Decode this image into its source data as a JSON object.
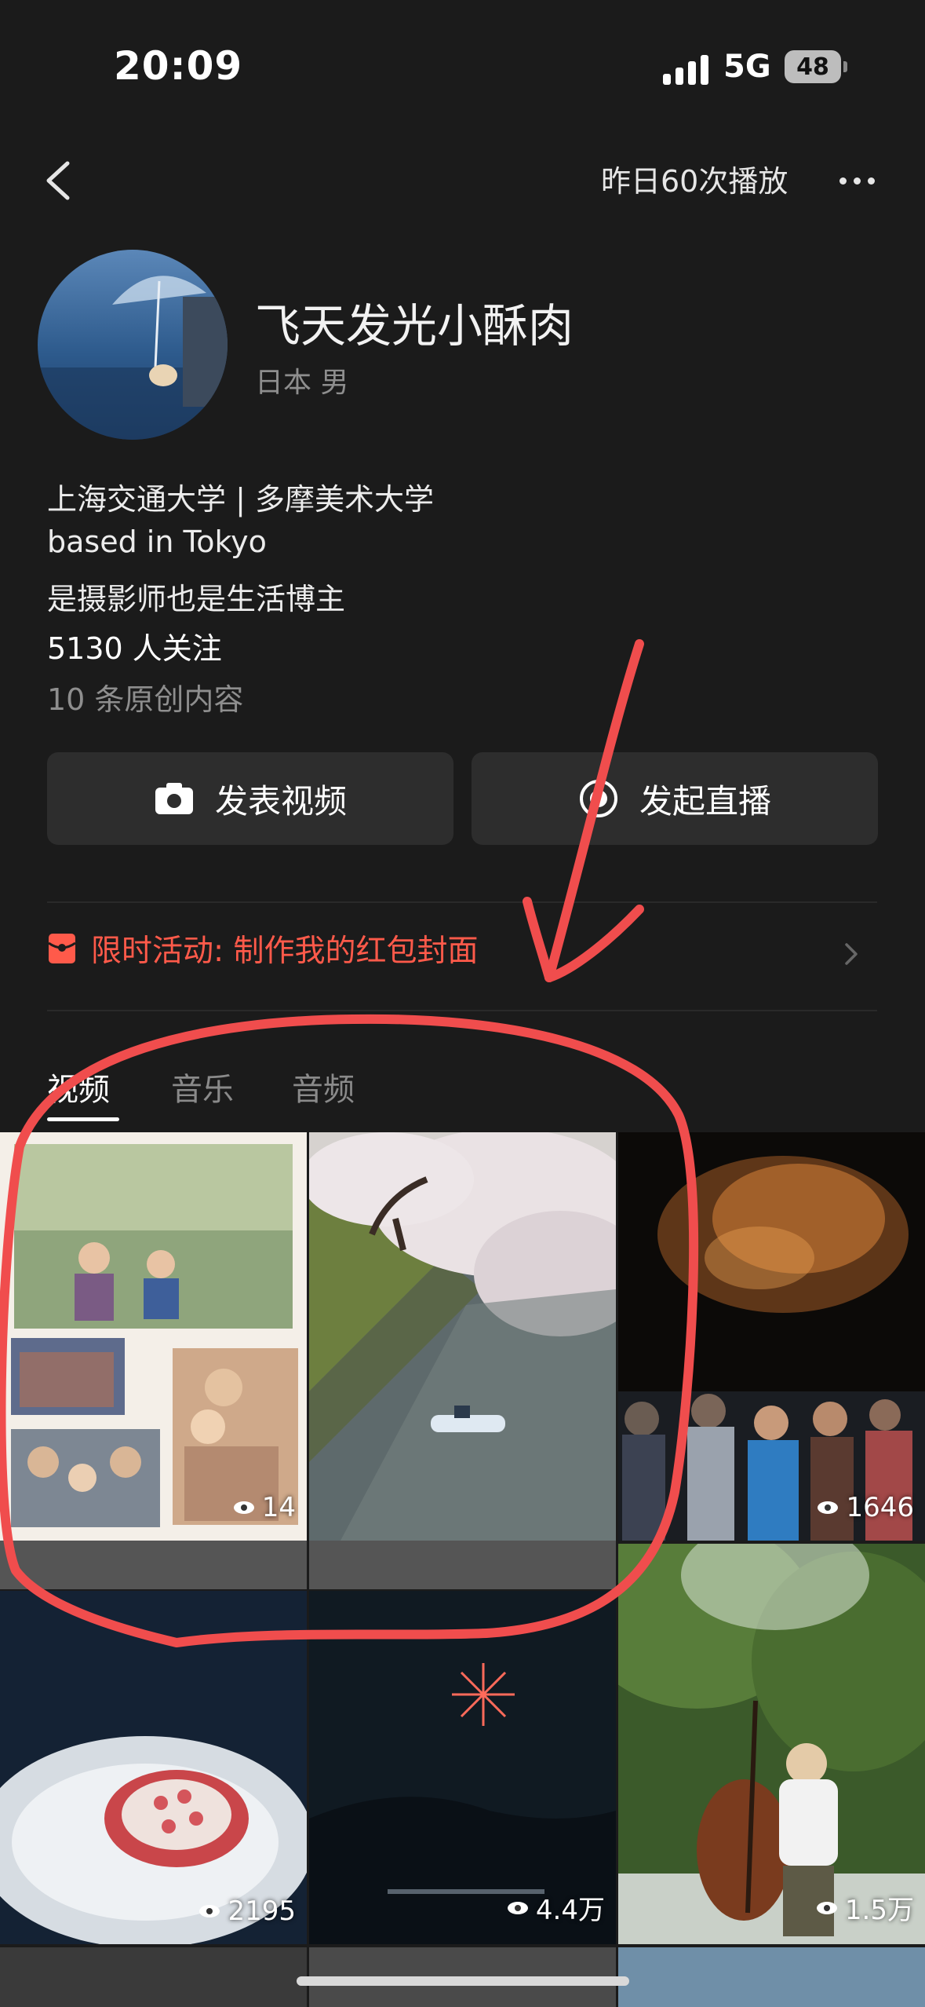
{
  "status_bar": {
    "time": "20:09",
    "network": "5G",
    "battery": "48"
  },
  "header": {
    "plays_label": "昨日60次播放"
  },
  "profile": {
    "name": "飞天发光小酥肉",
    "location_gender": "日本 男",
    "bio_lines": [
      "上海交通大学 | 多摩美术大学",
      "based in Tokyo",
      "是摄影师也是生活博主"
    ],
    "followers": "5130 人关注",
    "original_count": "10 条原创内容"
  },
  "actions": {
    "post_video": "发表视频",
    "go_live": "发起直播"
  },
  "promo": {
    "text": "限时活动: 制作我的红包封面"
  },
  "tabs": [
    {
      "label": "视频",
      "active": true
    },
    {
      "label": "音乐",
      "active": false
    },
    {
      "label": "音频",
      "active": false
    }
  ],
  "videos": [
    {
      "thumb": "family-photo-collage",
      "views": "14"
    },
    {
      "thumb": "cherry-blossom-boat",
      "views": ""
    },
    {
      "thumb": "fireworks-crowd",
      "views": "1646"
    },
    {
      "thumb": "pomegranate-plate",
      "views": "2195"
    },
    {
      "thumb": "night-fireworks",
      "views": "4.4万"
    },
    {
      "thumb": "bass-player-park",
      "views": "1.5万"
    }
  ],
  "colors": {
    "background": "#1b1b1b",
    "accent_red": "#ff5a4a",
    "button_bg": "#2d2d2d",
    "annotation": "#f04d4d"
  }
}
